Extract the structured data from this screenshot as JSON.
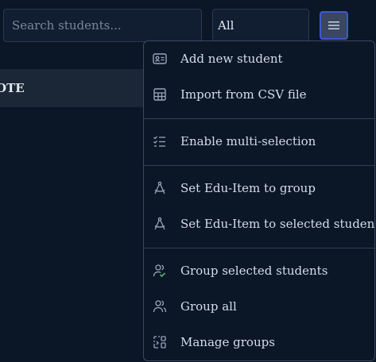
{
  "search": {
    "placeholder": "Search students..."
  },
  "filter": {
    "selected": "All"
  },
  "table": {
    "header_fragment": "OTE"
  },
  "menu": {
    "items": [
      {
        "label": "Add new student",
        "icon": "id-card-icon"
      },
      {
        "label": "Import from CSV file",
        "icon": "table-icon"
      },
      {
        "label": "Enable multi-selection",
        "icon": "checklist-icon"
      },
      {
        "label": "Set Edu-Item to group",
        "icon": "compass-icon"
      },
      {
        "label": "Set Edu-Item to selected students",
        "icon": "compass-icon"
      },
      {
        "label": "Group selected students",
        "icon": "users-check-icon"
      },
      {
        "label": "Group all",
        "icon": "users-icon"
      },
      {
        "label": "Manage groups",
        "icon": "group-manage-icon"
      }
    ]
  },
  "colors": {
    "accent": "#3b5bd1",
    "success": "#4cbb6a"
  }
}
